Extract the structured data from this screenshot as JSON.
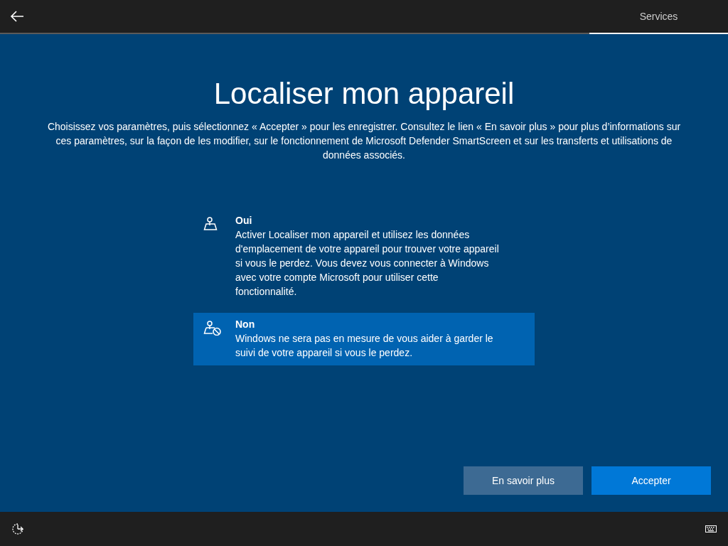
{
  "header": {
    "tabs": [
      {
        "label": "Services",
        "selected": true
      }
    ]
  },
  "title": "Localiser mon appareil",
  "description": "Choisissez vos paramètres, puis sélectionnez « Accepter » pour les enregistrer. Consultez le lien « En savoir plus » pour plus d’informations sur ces paramètres, sur la façon de les modifier, sur le fonctionnement de Microsoft Defender SmartScreen et sur les transferts et utilisations de données associés.",
  "options": [
    {
      "kind": "location",
      "label": "Oui",
      "text": "Activer Localiser mon appareil et utilisez les données d'emplacement de votre appareil pour trouver votre appareil si vous le perdez. Vous devez vous connecter à Windows avec votre compte Microsoft pour utiliser cette fonctionnalité.",
      "selected": false
    },
    {
      "kind": "location-off",
      "label": "Non",
      "text": "Windows ne sera pas en mesure de vous aider à garder le suivi de votre appareil si vous le perdez.",
      "selected": true
    }
  ],
  "buttons": [
    {
      "label": "En savoir plus",
      "kind": "secondary"
    },
    {
      "label": "Accepter",
      "kind": "primary"
    }
  ]
}
